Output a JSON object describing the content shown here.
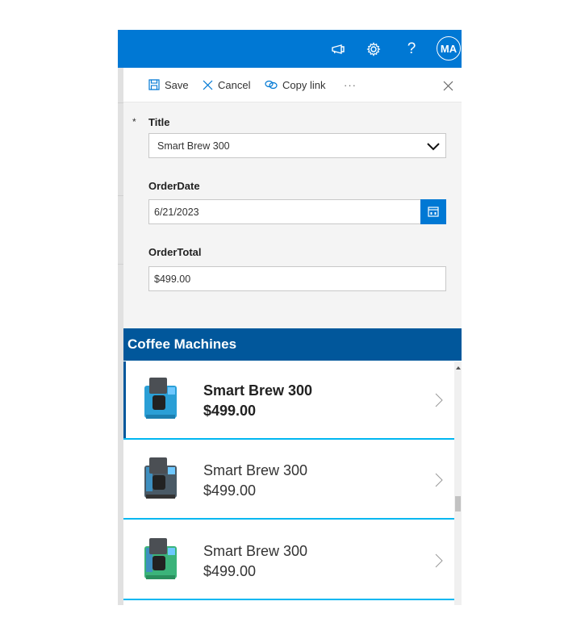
{
  "topbar": {
    "icons": [
      "megaphone-icon",
      "gear-icon",
      "help-icon"
    ],
    "help_glyph": "?",
    "avatar_initials": "MA",
    "color": "#0078d4"
  },
  "toolbar": {
    "save_label": "Save",
    "cancel_label": "Cancel",
    "copy_link_label": "Copy link",
    "more_label": "···"
  },
  "form": {
    "title": {
      "required_marker": "*",
      "label": "Title",
      "value": "Smart Brew 300"
    },
    "order_date": {
      "label": "OrderDate",
      "value": "6/21/2023"
    },
    "order_total": {
      "label": "OrderTotal",
      "value": "$499.00"
    }
  },
  "gallery": {
    "header": "Coffee Machines",
    "header_color": "#01579b",
    "separator_color": "#00b7f1",
    "items": [
      {
        "name": "Smart Brew 300",
        "price": "$499.00",
        "color": "#2a9fd6",
        "selected": true
      },
      {
        "name": "Smart Brew 300",
        "price": "$499.00",
        "color": "#4a5a66",
        "selected": false
      },
      {
        "name": "Smart Brew 300",
        "price": "$499.00",
        "color": "#3bb37a",
        "selected": false
      }
    ]
  }
}
